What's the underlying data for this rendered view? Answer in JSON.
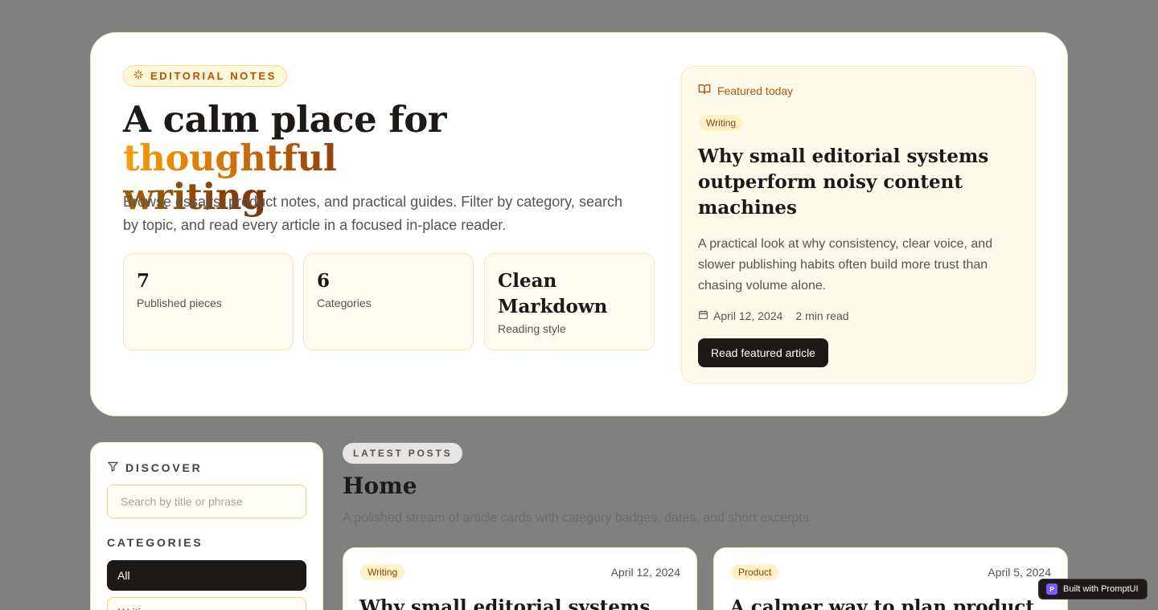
{
  "hero": {
    "badge": "EDITORIAL NOTES",
    "title_start": "A calm place for ",
    "title_accent": "thoughtful",
    "title_end": "writing",
    "description": "Browse essays, product notes, and practical guides. Filter by category, search by topic, and read every article in a focused in-place reader.",
    "stats": [
      {
        "value": "7",
        "label": "Published pieces"
      },
      {
        "value": "6",
        "label": "Categories"
      },
      {
        "value": "Clean Markdown",
        "label": "Reading style"
      }
    ]
  },
  "featured": {
    "heading": "Featured today",
    "category": "Writing",
    "title": "Why small editorial systems outperform noisy content machines",
    "excerpt": "A practical look at why consistency, clear voice, and slower publishing habits often build more trust than chasing volume alone.",
    "date": "April 12, 2024",
    "read_time": "2 min read",
    "button": "Read featured article"
  },
  "sidebar": {
    "heading": "DISCOVER",
    "search_placeholder": "Search by title or phrase",
    "categories_heading": "CATEGORIES",
    "categories": [
      "All",
      "Writing"
    ]
  },
  "main": {
    "badge": "LATEST POSTS",
    "title": "Home",
    "description": "A polished stream of article cards with category badges, dates, and short excerpts.",
    "cards": [
      {
        "category": "Writing",
        "date": "April 12, 2024",
        "title": "Why small editorial systems"
      },
      {
        "category": "Product",
        "date": "April 5, 2024",
        "title": "A calmer way to plan product"
      }
    ]
  },
  "footer_badge": {
    "logo": "P",
    "label": "Built with PromptUI"
  },
  "colors": {
    "accent": "#d97706",
    "dark": "#1c1917",
    "cream": "#fffbeb"
  }
}
